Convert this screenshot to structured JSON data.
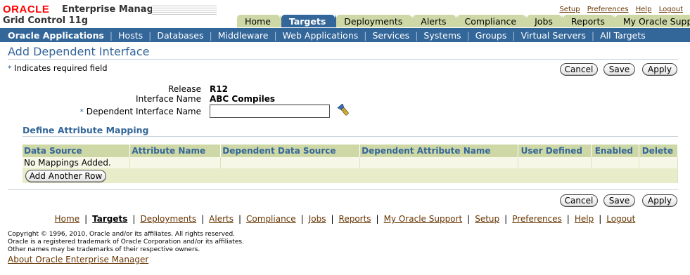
{
  "branding": {
    "oracle": "ORACLE",
    "product": "Enterprise Manager",
    "subtitle": "Grid Control 11g"
  },
  "global_links": [
    "Setup",
    "Preferences",
    "Help",
    "Logout"
  ],
  "tabs": [
    {
      "label": "Home",
      "active": false
    },
    {
      "label": "Targets",
      "active": true
    },
    {
      "label": "Deployments",
      "active": false
    },
    {
      "label": "Alerts",
      "active": false
    },
    {
      "label": "Compliance",
      "active": false
    },
    {
      "label": "Jobs",
      "active": false
    },
    {
      "label": "Reports",
      "active": false
    },
    {
      "label": "My Oracle Support",
      "active": false
    }
  ],
  "subnav": [
    {
      "label": "Oracle Applications",
      "active": true
    },
    {
      "label": "Hosts"
    },
    {
      "label": "Databases"
    },
    {
      "label": "Middleware"
    },
    {
      "label": "Web Applications"
    },
    {
      "label": "Services"
    },
    {
      "label": "Systems"
    },
    {
      "label": "Groups"
    },
    {
      "label": "Virtual Servers"
    },
    {
      "label": "All Targets"
    }
  ],
  "page": {
    "title": "Add Dependent Interface",
    "required_note": "Indicates required field",
    "required_mark": "*"
  },
  "buttons": {
    "cancel": "Cancel",
    "save": "Save",
    "apply": "Apply",
    "add_row": "Add Another Row"
  },
  "form": {
    "release_label": "Release",
    "release_value": "R12",
    "interface_name_label": "Interface Name",
    "interface_name_value": "ABC Compiles",
    "dependent_label": "Dependent Interface Name",
    "dependent_value": ""
  },
  "mapping": {
    "section_title": "Define Attribute Mapping",
    "columns": [
      "Data Source",
      "Attribute Name",
      "Dependent Data Source",
      "Dependent Attribute Name",
      "User Defined",
      "Enabled",
      "Delete"
    ],
    "empty_text": "No Mappings Added."
  },
  "footer": {
    "links": [
      {
        "label": "Home"
      },
      {
        "label": "Targets",
        "current": true
      },
      {
        "label": "Deployments"
      },
      {
        "label": "Alerts"
      },
      {
        "label": "Compliance"
      },
      {
        "label": "Jobs"
      },
      {
        "label": "Reports"
      },
      {
        "label": "My Oracle Support"
      },
      {
        "label": "Setup"
      },
      {
        "label": "Preferences"
      },
      {
        "label": "Help"
      },
      {
        "label": "Logout"
      }
    ],
    "copyright": [
      "Copyright © 1996, 2010, Oracle and/or its affiliates. All rights reserved.",
      "Oracle is a registered trademark of Oracle Corporation and/or its affiliates.",
      "Other names may be trademarks of their respective owners."
    ],
    "about": "About Oracle Enterprise Manager"
  },
  "colors": {
    "brand_red": "#ff0000",
    "nav_blue": "#336699",
    "tab_khaki": "#ced7a6",
    "link_brown": "#663300"
  },
  "icons": {
    "search": "flashlight-search-icon"
  }
}
